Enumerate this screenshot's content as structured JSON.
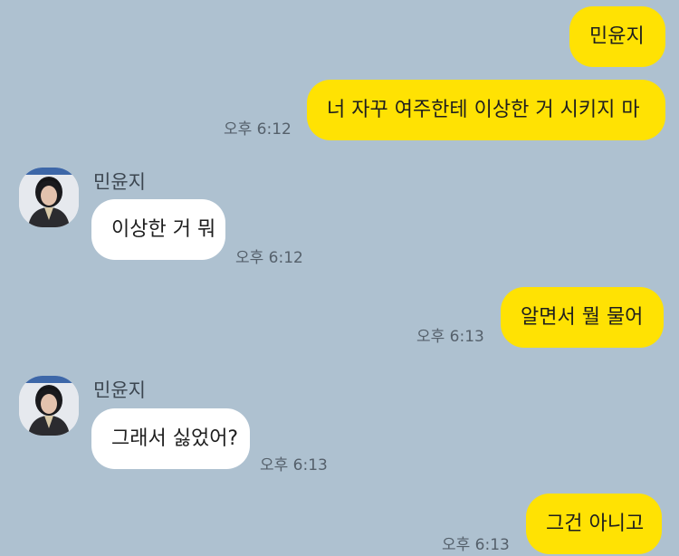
{
  "chat": {
    "messages": [
      {
        "sender": "me",
        "text": "민윤지",
        "time": ""
      },
      {
        "sender": "me",
        "text": "너 자꾸 여주한테 이상한 거 시키지 마",
        "time": "오후 6:12"
      },
      {
        "sender": "other",
        "name": "민윤지",
        "text": "이상한 거 뭐",
        "time": "오후 6:12"
      },
      {
        "sender": "me",
        "text": "알면서 뭘 물어",
        "time": "오후 6:13"
      },
      {
        "sender": "other",
        "name": "민윤지",
        "text": "그래서 싫었어?",
        "time": "오후 6:13"
      },
      {
        "sender": "me",
        "text": "그건 아니고",
        "time": "오후 6:13"
      }
    ]
  },
  "colors": {
    "background": "#aec1d0",
    "my_bubble": "#ffe203",
    "other_bubble": "#ffffff"
  },
  "icons": {
    "avatar": "profile-photo"
  }
}
